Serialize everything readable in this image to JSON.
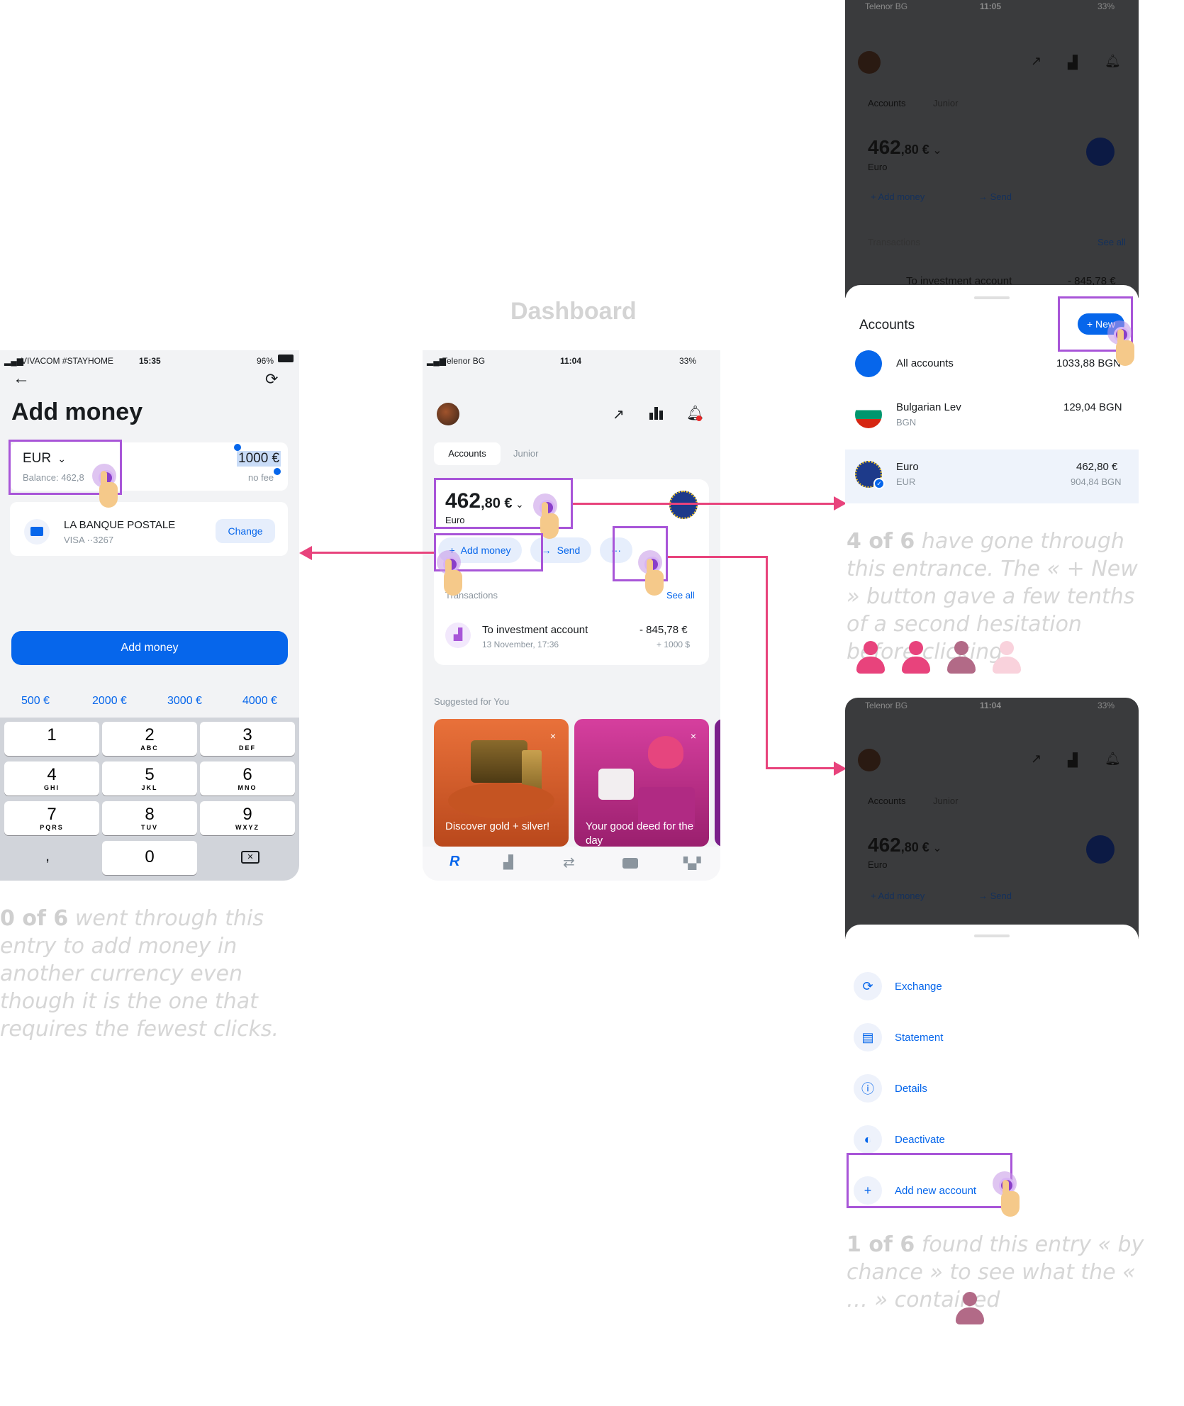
{
  "title": "Dashboard",
  "add_money_screen": {
    "status": {
      "carrier": "VIVACOM #STAYHOME",
      "time": "15:35",
      "battery": "96%"
    },
    "title": "Add money",
    "currency": "EUR",
    "balance": "Balance: 462,8",
    "amount": "1000 €",
    "fee": "no fee",
    "bank_name": "LA BANQUE POSTALE",
    "bank_card": "VISA ··3267",
    "change_label": "Change",
    "add_button": "Add money",
    "presets": [
      "500 €",
      "2000 €",
      "3000 €",
      "4000 €"
    ],
    "keys": [
      {
        "n": "1",
        "l": ""
      },
      {
        "n": "2",
        "l": "ABC"
      },
      {
        "n": "3",
        "l": "DEF"
      },
      {
        "n": "4",
        "l": "GHI"
      },
      {
        "n": "5",
        "l": "JKL"
      },
      {
        "n": "6",
        "l": "MNO"
      },
      {
        "n": "7",
        "l": "PQRS"
      },
      {
        "n": "8",
        "l": "TUV"
      },
      {
        "n": "9",
        "l": "WXYZ"
      },
      {
        "n": ",",
        "l": ""
      },
      {
        "n": "0",
        "l": ""
      }
    ]
  },
  "dashboard": {
    "status": {
      "carrier": "Telenor BG",
      "time": "11:04",
      "battery": "33%"
    },
    "tabs": [
      "Accounts",
      "Junior"
    ],
    "balance_main": "462",
    "balance_dec": ",80 €",
    "currency_name": "Euro",
    "add_money": "Add money",
    "send": "Send",
    "more": "···",
    "transactions_label": "Transactions",
    "see_all": "See all",
    "tx_title": "To investment account",
    "tx_date": "13 November, 17:36",
    "tx_amount": "- 845,78 €",
    "tx_sub": "+ 1000 $",
    "suggested": "Suggested for You",
    "card1": "Discover gold + silver!",
    "card2": "Your good deed for the day",
    "nav_r": "R"
  },
  "accounts_screen": {
    "status": {
      "carrier": "Telenor BG",
      "time": "11:05",
      "battery": "33%"
    },
    "tabs": [
      "Accounts",
      "Junior"
    ],
    "balance_main": "462",
    "balance_dec": ",80 €",
    "currency_name": "Euro",
    "add_money": "Add money",
    "send": "Send",
    "transactions_label": "Transactions",
    "see_all": "See all",
    "tx_title": "To investment account",
    "tx_amount": "- 845,78 €",
    "sheet_title": "Accounts",
    "new_button": "+ New",
    "items": [
      {
        "name": "All accounts",
        "code": "",
        "amount": "1033,88 BGN",
        "sub": ""
      },
      {
        "name": "Bulgarian Lev",
        "code": "BGN",
        "amount": "129,04 BGN",
        "sub": ""
      },
      {
        "name": "Euro",
        "code": "EUR",
        "amount": "462,80 €",
        "sub": "904,84 BGN"
      }
    ]
  },
  "menu_screen": {
    "status": {
      "carrier": "Telenor BG",
      "time": "11:04",
      "battery": "33%"
    },
    "tabs": [
      "Accounts",
      "Junior"
    ],
    "balance_main": "462",
    "balance_dec": ",80 €",
    "currency_name": "Euro",
    "add_money": "Add money",
    "send": "Send",
    "items": [
      "Exchange",
      "Statement",
      "Details",
      "Deactivate",
      "Add new account"
    ]
  },
  "notes": {
    "left_bold": "0 of 6",
    "left_text": " went through this entry to add money in another currency even though it is the one that requires the fewest clicks.",
    "right1_bold": "4 of 6",
    "right1_text": " have gone through this entrance. The « + New » button gave a few tenths of a second hesitation before clicking",
    "right2_bold": "1 of 6",
    "right2_text": " found this entry « by chance » to see what the « … » contained"
  },
  "colors": {
    "accent": "#0666eb",
    "highlight": "#a855d8",
    "arrow": "#e8437c",
    "person": "#e8437c"
  }
}
